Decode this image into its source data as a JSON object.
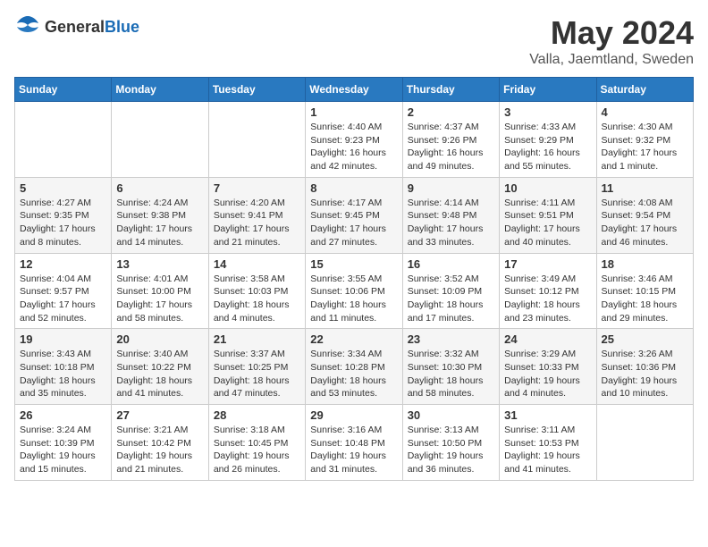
{
  "header": {
    "logo_general": "General",
    "logo_blue": "Blue",
    "title": "May 2024",
    "location": "Valla, Jaemtland, Sweden"
  },
  "weekdays": [
    "Sunday",
    "Monday",
    "Tuesday",
    "Wednesday",
    "Thursday",
    "Friday",
    "Saturday"
  ],
  "weeks": [
    [
      {
        "day": "",
        "info": ""
      },
      {
        "day": "",
        "info": ""
      },
      {
        "day": "",
        "info": ""
      },
      {
        "day": "1",
        "info": "Sunrise: 4:40 AM\nSunset: 9:23 PM\nDaylight: 16 hours\nand 42 minutes."
      },
      {
        "day": "2",
        "info": "Sunrise: 4:37 AM\nSunset: 9:26 PM\nDaylight: 16 hours\nand 49 minutes."
      },
      {
        "day": "3",
        "info": "Sunrise: 4:33 AM\nSunset: 9:29 PM\nDaylight: 16 hours\nand 55 minutes."
      },
      {
        "day": "4",
        "info": "Sunrise: 4:30 AM\nSunset: 9:32 PM\nDaylight: 17 hours\nand 1 minute."
      }
    ],
    [
      {
        "day": "5",
        "info": "Sunrise: 4:27 AM\nSunset: 9:35 PM\nDaylight: 17 hours\nand 8 minutes."
      },
      {
        "day": "6",
        "info": "Sunrise: 4:24 AM\nSunset: 9:38 PM\nDaylight: 17 hours\nand 14 minutes."
      },
      {
        "day": "7",
        "info": "Sunrise: 4:20 AM\nSunset: 9:41 PM\nDaylight: 17 hours\nand 21 minutes."
      },
      {
        "day": "8",
        "info": "Sunrise: 4:17 AM\nSunset: 9:45 PM\nDaylight: 17 hours\nand 27 minutes."
      },
      {
        "day": "9",
        "info": "Sunrise: 4:14 AM\nSunset: 9:48 PM\nDaylight: 17 hours\nand 33 minutes."
      },
      {
        "day": "10",
        "info": "Sunrise: 4:11 AM\nSunset: 9:51 PM\nDaylight: 17 hours\nand 40 minutes."
      },
      {
        "day": "11",
        "info": "Sunrise: 4:08 AM\nSunset: 9:54 PM\nDaylight: 17 hours\nand 46 minutes."
      }
    ],
    [
      {
        "day": "12",
        "info": "Sunrise: 4:04 AM\nSunset: 9:57 PM\nDaylight: 17 hours\nand 52 minutes."
      },
      {
        "day": "13",
        "info": "Sunrise: 4:01 AM\nSunset: 10:00 PM\nDaylight: 17 hours\nand 58 minutes."
      },
      {
        "day": "14",
        "info": "Sunrise: 3:58 AM\nSunset: 10:03 PM\nDaylight: 18 hours\nand 4 minutes."
      },
      {
        "day": "15",
        "info": "Sunrise: 3:55 AM\nSunset: 10:06 PM\nDaylight: 18 hours\nand 11 minutes."
      },
      {
        "day": "16",
        "info": "Sunrise: 3:52 AM\nSunset: 10:09 PM\nDaylight: 18 hours\nand 17 minutes."
      },
      {
        "day": "17",
        "info": "Sunrise: 3:49 AM\nSunset: 10:12 PM\nDaylight: 18 hours\nand 23 minutes."
      },
      {
        "day": "18",
        "info": "Sunrise: 3:46 AM\nSunset: 10:15 PM\nDaylight: 18 hours\nand 29 minutes."
      }
    ],
    [
      {
        "day": "19",
        "info": "Sunrise: 3:43 AM\nSunset: 10:18 PM\nDaylight: 18 hours\nand 35 minutes."
      },
      {
        "day": "20",
        "info": "Sunrise: 3:40 AM\nSunset: 10:22 PM\nDaylight: 18 hours\nand 41 minutes."
      },
      {
        "day": "21",
        "info": "Sunrise: 3:37 AM\nSunset: 10:25 PM\nDaylight: 18 hours\nand 47 minutes."
      },
      {
        "day": "22",
        "info": "Sunrise: 3:34 AM\nSunset: 10:28 PM\nDaylight: 18 hours\nand 53 minutes."
      },
      {
        "day": "23",
        "info": "Sunrise: 3:32 AM\nSunset: 10:30 PM\nDaylight: 18 hours\nand 58 minutes."
      },
      {
        "day": "24",
        "info": "Sunrise: 3:29 AM\nSunset: 10:33 PM\nDaylight: 19 hours\nand 4 minutes."
      },
      {
        "day": "25",
        "info": "Sunrise: 3:26 AM\nSunset: 10:36 PM\nDaylight: 19 hours\nand 10 minutes."
      }
    ],
    [
      {
        "day": "26",
        "info": "Sunrise: 3:24 AM\nSunset: 10:39 PM\nDaylight: 19 hours\nand 15 minutes."
      },
      {
        "day": "27",
        "info": "Sunrise: 3:21 AM\nSunset: 10:42 PM\nDaylight: 19 hours\nand 21 minutes."
      },
      {
        "day": "28",
        "info": "Sunrise: 3:18 AM\nSunset: 10:45 PM\nDaylight: 19 hours\nand 26 minutes."
      },
      {
        "day": "29",
        "info": "Sunrise: 3:16 AM\nSunset: 10:48 PM\nDaylight: 19 hours\nand 31 minutes."
      },
      {
        "day": "30",
        "info": "Sunrise: 3:13 AM\nSunset: 10:50 PM\nDaylight: 19 hours\nand 36 minutes."
      },
      {
        "day": "31",
        "info": "Sunrise: 3:11 AM\nSunset: 10:53 PM\nDaylight: 19 hours\nand 41 minutes."
      },
      {
        "day": "",
        "info": ""
      }
    ]
  ]
}
